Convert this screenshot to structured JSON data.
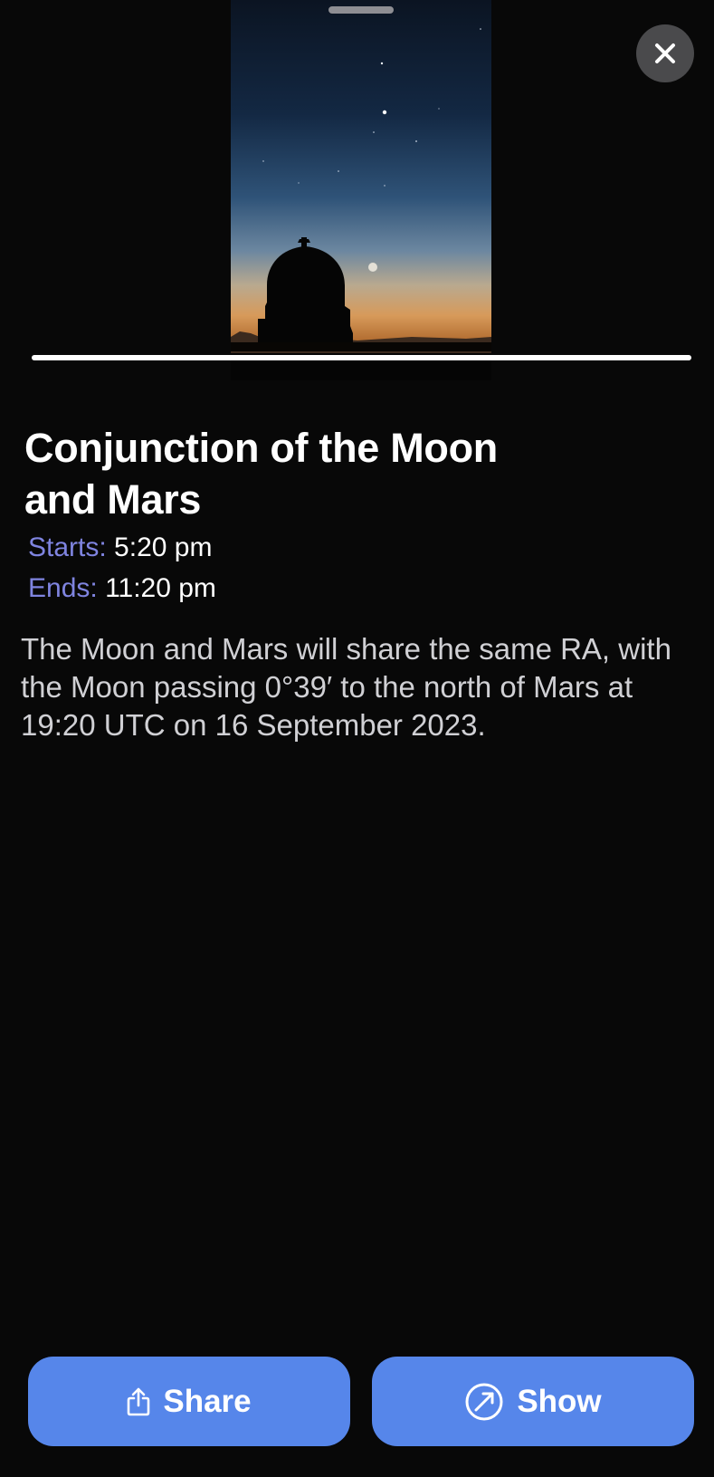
{
  "app": {
    "accent_color": "#5686ea",
    "label_color": "#7f84e0"
  },
  "media": {
    "progress_fraction": 1.0,
    "image_icon": "observatory-twilight-photo"
  },
  "close": {
    "icon": "close-icon"
  },
  "event": {
    "title": "Conjunction of the Moon and Mars",
    "starts_label": "Starts:",
    "starts_value": "5:20 pm",
    "ends_label": "Ends:",
    "ends_value": "11:20 pm",
    "description": "The Moon and Mars will share the same RA, with the Moon passing 0°39′ to the north of Mars at 19:20 UTC on 16 September 2023."
  },
  "actions": {
    "share_label": "Share",
    "share_icon": "share-icon",
    "show_label": "Show",
    "show_icon": "compass-arrow-icon"
  }
}
